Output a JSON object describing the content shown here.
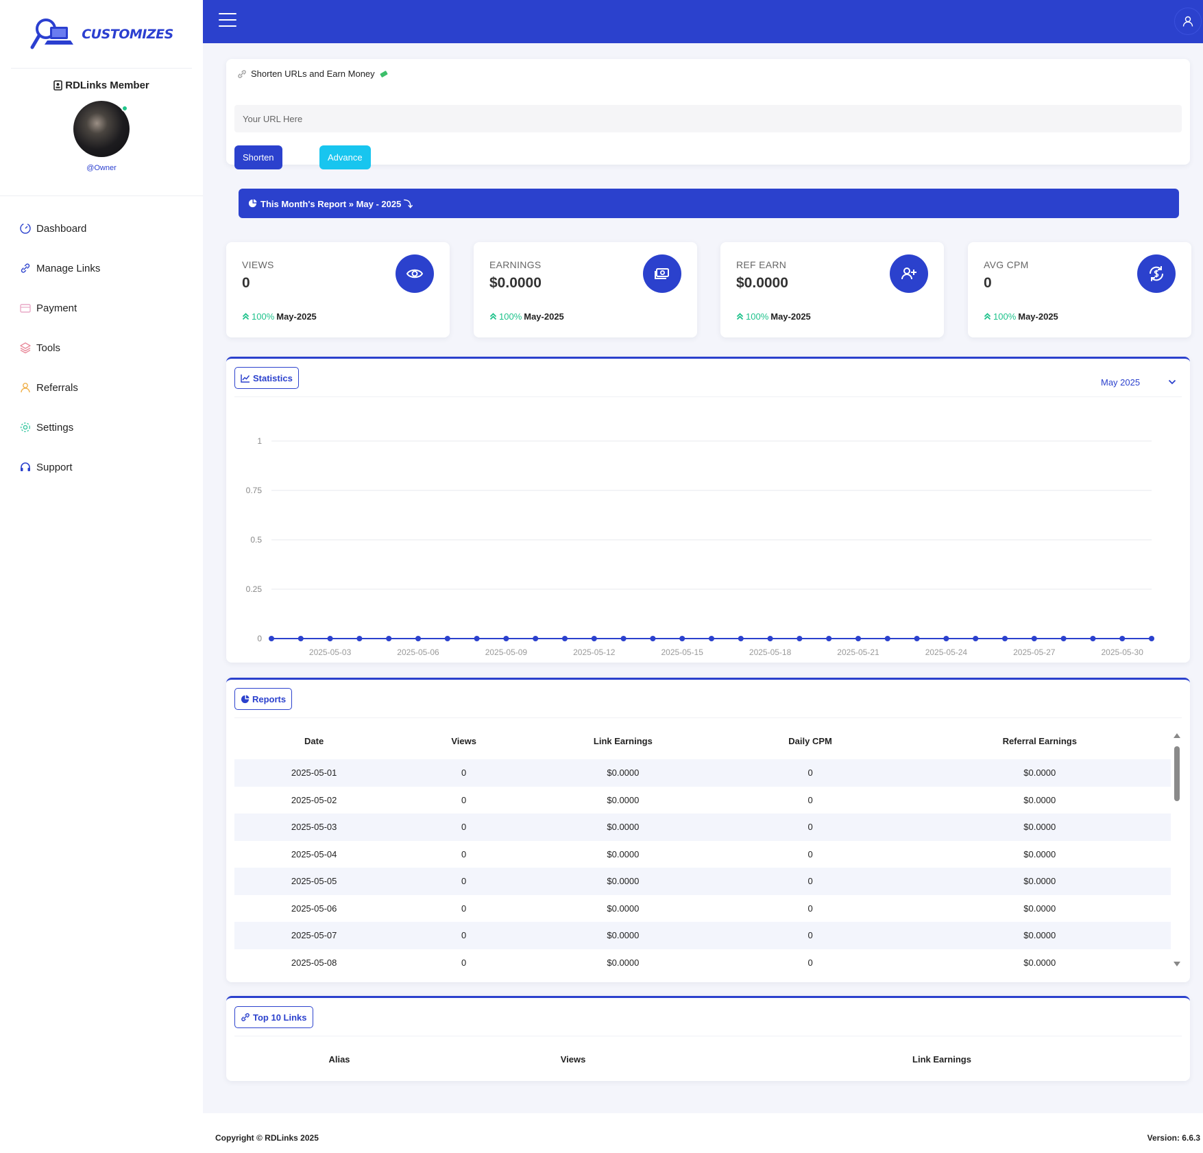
{
  "brand": {
    "name": "CUSTOMIZES"
  },
  "profile": {
    "title": "RDLinks Member",
    "handle": "@Owner"
  },
  "nav": {
    "items": [
      {
        "label": "Dashboard",
        "icon": "dashboard-icon"
      },
      {
        "label": "Manage Links",
        "icon": "link-icon"
      },
      {
        "label": "Payment",
        "icon": "wallet-icon"
      },
      {
        "label": "Tools",
        "icon": "layers-icon"
      },
      {
        "label": "Referrals",
        "icon": "users-icon"
      },
      {
        "label": "Settings",
        "icon": "gear-icon"
      },
      {
        "label": "Support",
        "icon": "headset-icon"
      }
    ]
  },
  "shorten": {
    "heading": "Shorten URLs and Earn Money",
    "placeholder": "Your URL Here",
    "shorten_label": "Shorten",
    "advance_label": "Advance"
  },
  "report_banner": {
    "text": "This Month's Report » May - 2025 ⤵"
  },
  "stats": [
    {
      "label": "VIEWS",
      "value": "0",
      "change": "100%",
      "period": "May-2025",
      "icon": "eye-icon"
    },
    {
      "label": "EARNINGS",
      "value": "$0.0000",
      "change": "100%",
      "period": "May-2025",
      "icon": "money-icon"
    },
    {
      "label": "REF EARN",
      "value": "$0.0000",
      "change": "100%",
      "period": "May-2025",
      "icon": "user-plus-icon"
    },
    {
      "label": "AVG CPM",
      "value": "0",
      "change": "100%",
      "period": "May-2025",
      "icon": "dollar-cycle-icon"
    }
  ],
  "statistics": {
    "tag": "Statistics",
    "month_selected": "May 2025"
  },
  "chart_data": {
    "type": "line",
    "x": [
      "2025-05-01",
      "2025-05-02",
      "2025-05-03",
      "2025-05-04",
      "2025-05-05",
      "2025-05-06",
      "2025-05-07",
      "2025-05-08",
      "2025-05-09",
      "2025-05-10",
      "2025-05-11",
      "2025-05-12",
      "2025-05-13",
      "2025-05-14",
      "2025-05-15",
      "2025-05-16",
      "2025-05-17",
      "2025-05-18",
      "2025-05-19",
      "2025-05-20",
      "2025-05-21",
      "2025-05-22",
      "2025-05-23",
      "2025-05-24",
      "2025-05-25",
      "2025-05-26",
      "2025-05-27",
      "2025-05-28",
      "2025-05-29",
      "2025-05-30",
      "2025-05-31"
    ],
    "x_tick_labels": [
      "2025-05-03",
      "2025-05-06",
      "2025-05-09",
      "2025-05-12",
      "2025-05-15",
      "2025-05-18",
      "2025-05-21",
      "2025-05-24",
      "2025-05-27",
      "2025-05-30"
    ],
    "series": [
      {
        "values": [
          0,
          0,
          0,
          0,
          0,
          0,
          0,
          0,
          0,
          0,
          0,
          0,
          0,
          0,
          0,
          0,
          0,
          0,
          0,
          0,
          0,
          0,
          0,
          0,
          0,
          0,
          0,
          0,
          0,
          0,
          0
        ]
      }
    ],
    "y_ticks": [
      "0",
      "0.25",
      "0.5",
      "0.75",
      "1"
    ],
    "ylim": [
      0,
      1
    ],
    "grid": true,
    "color": "#2b41cd"
  },
  "reports": {
    "tag": "Reports",
    "columns": [
      "Date",
      "Views",
      "Link Earnings",
      "Daily CPM",
      "Referral Earnings"
    ],
    "rows": [
      [
        "2025-05-01",
        "0",
        "$0.0000",
        "0",
        "$0.0000"
      ],
      [
        "2025-05-02",
        "0",
        "$0.0000",
        "0",
        "$0.0000"
      ],
      [
        "2025-05-03",
        "0",
        "$0.0000",
        "0",
        "$0.0000"
      ],
      [
        "2025-05-04",
        "0",
        "$0.0000",
        "0",
        "$0.0000"
      ],
      [
        "2025-05-05",
        "0",
        "$0.0000",
        "0",
        "$0.0000"
      ],
      [
        "2025-05-06",
        "0",
        "$0.0000",
        "0",
        "$0.0000"
      ],
      [
        "2025-05-07",
        "0",
        "$0.0000",
        "0",
        "$0.0000"
      ],
      [
        "2025-05-08",
        "0",
        "$0.0000",
        "0",
        "$0.0000"
      ]
    ]
  },
  "top_links": {
    "tag": "Top 10 Links",
    "columns": [
      "Alias",
      "Views",
      "Link Earnings"
    ]
  },
  "footer": {
    "copyright": "Copyright © RDLinks 2025",
    "version": "Version: 6.6.3"
  },
  "colors": {
    "primary": "#2b41cd",
    "accent": "#18c5ef",
    "success": "#1ec28b"
  }
}
